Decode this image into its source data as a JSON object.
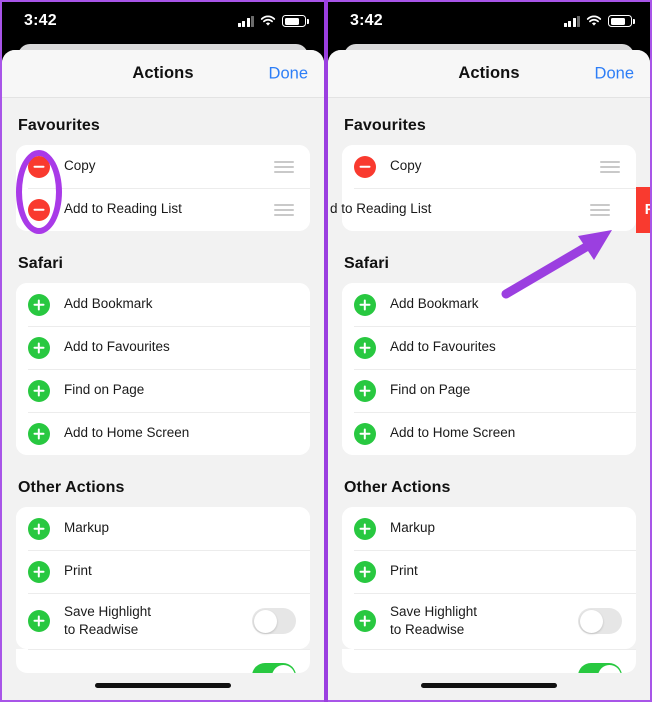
{
  "status_bar": {
    "time": "3:42",
    "signal_icon": "cellular-signal-icon",
    "wifi_icon": "wifi-icon",
    "battery_icon": "battery-icon"
  },
  "sheet": {
    "title": "Actions",
    "done_label": "Done"
  },
  "colors": {
    "accent_blue": "#2d7ef7",
    "remove_red": "#f93a2f",
    "add_green": "#28c840",
    "annotation_purple": "#a93ae8",
    "sheet_background": "#f2f2f2",
    "card_background": "#ffffff"
  },
  "sections": [
    {
      "title": "Favourites",
      "rows": [
        {
          "label": "Copy",
          "icon": "minus-circle-icon",
          "handle": true
        },
        {
          "label": "Add to Reading List",
          "icon": "minus-circle-icon",
          "handle": true
        }
      ]
    },
    {
      "title": "Safari",
      "rows": [
        {
          "label": "Add Bookmark",
          "icon": "plus-circle-icon"
        },
        {
          "label": "Add to Favourites",
          "icon": "plus-circle-icon"
        },
        {
          "label": "Find on Page",
          "icon": "plus-circle-icon"
        },
        {
          "label": "Add to Home Screen",
          "icon": "plus-circle-icon"
        }
      ]
    },
    {
      "title": "Other Actions",
      "rows": [
        {
          "label": "Markup",
          "icon": "plus-circle-icon"
        },
        {
          "label": "Print",
          "icon": "plus-circle-icon"
        },
        {
          "label": "Save Highlight\nto Readwise",
          "icon": "plus-circle-icon",
          "toggle": "off"
        }
      ]
    }
  ],
  "right_panel": {
    "swiped_row_label": "d to Reading List",
    "remove_label": "Remove"
  },
  "annotations": {
    "oval_target": "minus-circle-buttons",
    "arrow_target": "remove-button"
  }
}
